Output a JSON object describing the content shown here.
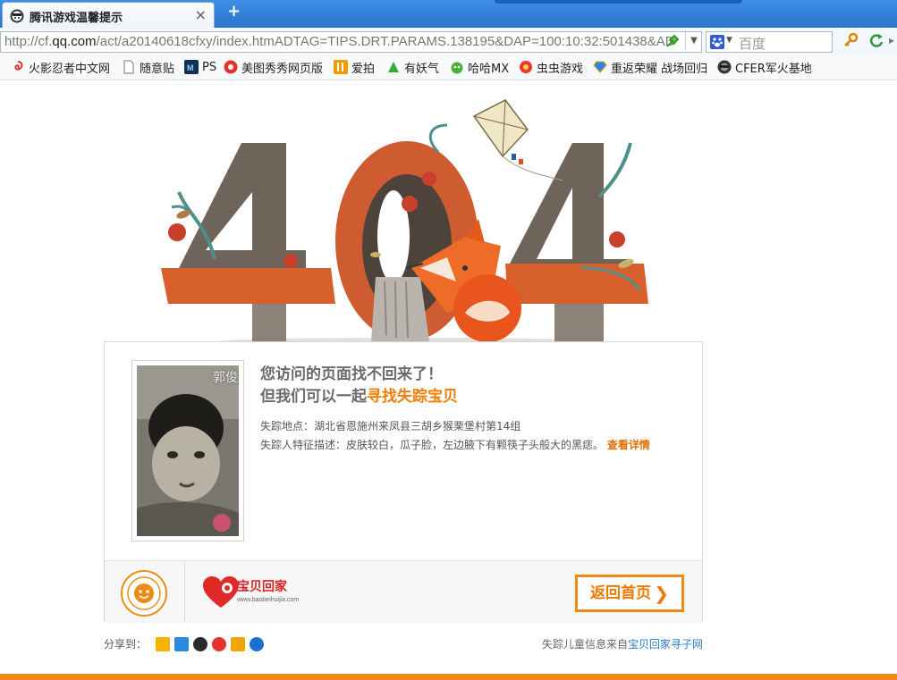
{
  "browser": {
    "tab_title": "腾讯游戏温馨提示",
    "tab_close": "×",
    "new_tab": "+",
    "url_prefix": "http://cf.",
    "url_host": "qq.com",
    "url_path": "/act/a20140618cfxy/index.htmADTAG=TIPS.DRT.PARAMS.138195&DAP=100:10:32:501438&AD",
    "search_placeholder": "百度"
  },
  "bookmarks": [
    {
      "label": "火影忍者中文网",
      "icon": "naruto-icon"
    },
    {
      "label": "随意贴",
      "icon": "page-icon"
    },
    {
      "label": "PS",
      "icon": "ps-icon"
    },
    {
      "label": "美图秀秀网页版",
      "icon": "meitu-icon"
    },
    {
      "label": "爱拍",
      "icon": "aipai-icon"
    },
    {
      "label": "有妖气",
      "icon": "youyaoqi-icon"
    },
    {
      "label": "哈哈MX",
      "icon": "haha-icon"
    },
    {
      "label": "虫虫游戏",
      "icon": "chongchong-icon"
    },
    {
      "label": "重返荣耀 战场回归",
      "icon": "diamond-icon"
    },
    {
      "label": "CFER军火基地",
      "icon": "cfer-icon"
    }
  ],
  "content": {
    "photo_name": "郭俊",
    "headline_line1": "您访问的页面找不回来了！",
    "headline_line2_prefix": "但我们可以一起",
    "headline_line2_highlight": "寻找失踪宝贝",
    "location_label": "失踪地点：",
    "location_value": "湖北省恩施州来凤县三胡乡猴栗堡村第14组",
    "desc_label": "失踪人特征描述：",
    "desc_value": "皮肤较白，瓜子脸，左边腋下有颗筷子头般大的黑痣。",
    "more_link": "查看详情",
    "home_button": "返回首页",
    "home_chevron": "❯",
    "baobei_logo_text": "宝贝回家",
    "baobei_logo_url": "www.baobeihuijia.com",
    "photo_watermark": "宝贝回家"
  },
  "footer": {
    "share_label": "分享到：",
    "share_icons": [
      "qzone-icon",
      "pengyou-icon",
      "qq-icon",
      "weibo-icon",
      "tencent-weibo-icon",
      "renren-icon"
    ],
    "source_prefix": "失踪儿童信息来自",
    "source_link": "宝贝回家寻子网"
  },
  "colors": {
    "accent_orange": "#f08a16",
    "highlight_text": "#f07f06",
    "link_blue": "#2b7dc4",
    "tab_blue": "#3e8ee6"
  }
}
